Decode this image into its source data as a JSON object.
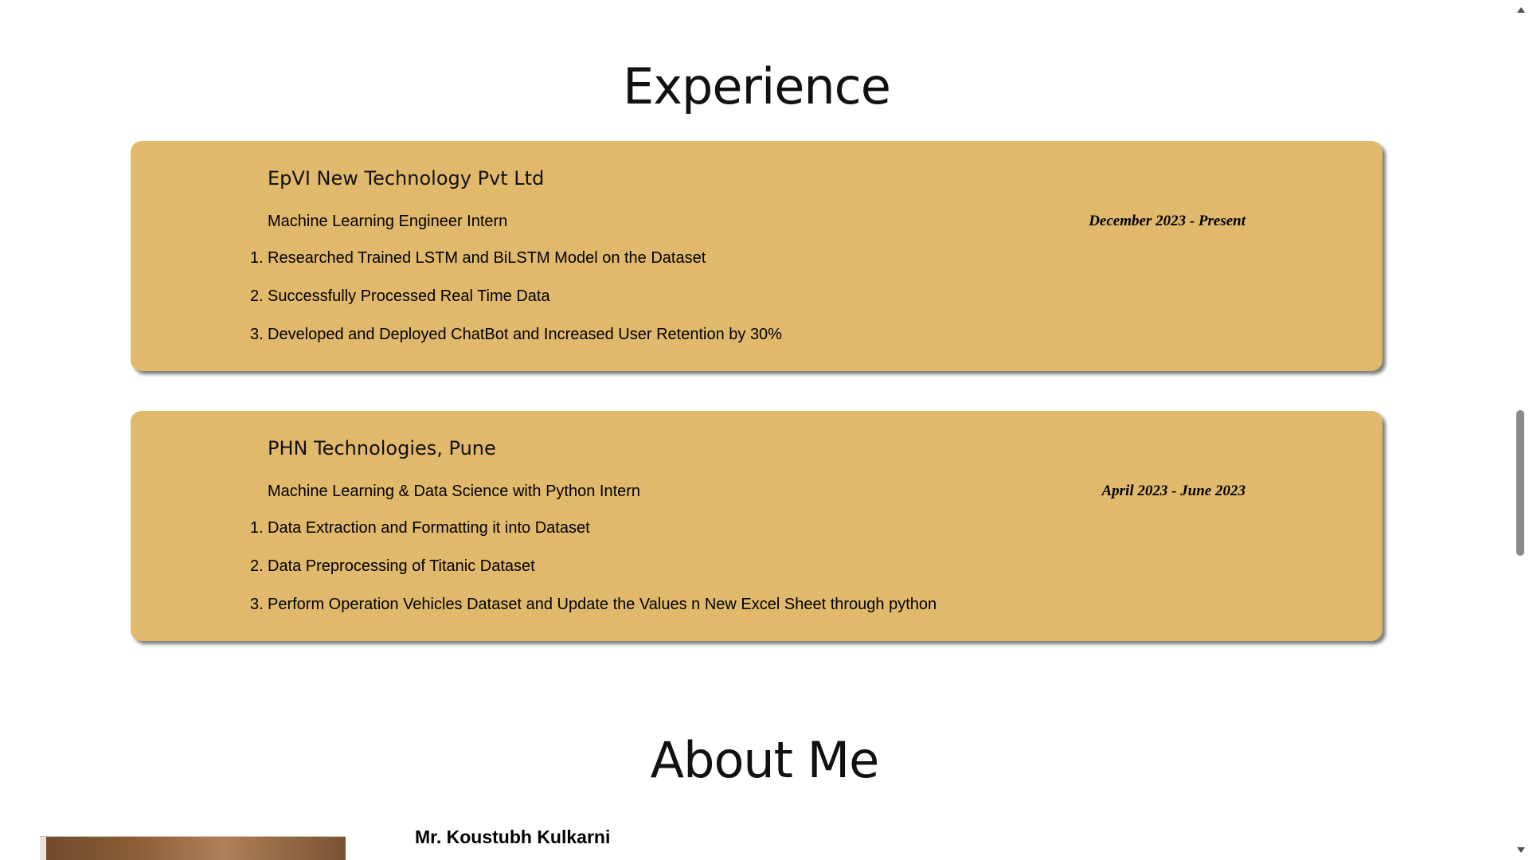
{
  "experience": {
    "heading": "Experience",
    "jobs": [
      {
        "company": "EpVI New Technology Pvt Ltd",
        "role": "Machine Learning Engineer Intern",
        "dates": "December 2023 - Present",
        "duties": [
          "Researched Trained LSTM and BiLSTM Model on the Dataset",
          "Successfully Processed Real Time Data",
          "Developed and Deployed ChatBot and Increased User Retention by 30%"
        ]
      },
      {
        "company": "PHN Technologies, Pune",
        "role": "Machine Learning & Data Science with Python Intern",
        "dates": "April 2023 - June 2023",
        "duties": [
          "Data Extraction and Formatting it into Dataset",
          "Data Preprocessing of Titanic Dataset",
          "Perform Operation Vehicles Dataset and Update the Values n New Excel Sheet through python"
        ]
      }
    ]
  },
  "about": {
    "heading": "About Me",
    "name": "Mr. Koustubh Kulkarni"
  },
  "list_numbers": [
    "1.",
    "2.",
    "3."
  ],
  "colors": {
    "card_background": "#e1b96c",
    "page_background": "#ffffff"
  }
}
